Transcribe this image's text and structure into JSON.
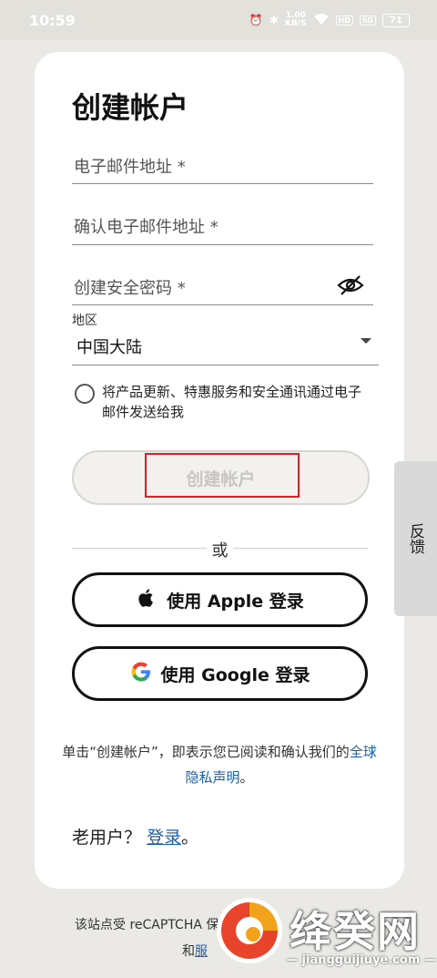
{
  "status_bar": {
    "time": "10:59",
    "net_speed_value": "1.00",
    "net_speed_unit": "KB/S",
    "hd_badge": "HD",
    "signal_label": "5G",
    "battery": "71"
  },
  "form": {
    "title": "创建帐户",
    "email_placeholder": "电子邮件地址 *",
    "confirm_email_placeholder": "确认电子邮件地址 *",
    "password_placeholder": "创建安全密码 *",
    "region_label": "地区",
    "region_value": "中国大陆",
    "marketing_optin": "将产品更新、特惠服务和安全通讯通过电子邮件发送给我",
    "create_button": "创建帐户",
    "or": "或",
    "apple_button": "使用 Apple 登录",
    "google_button": "使用 Google 登录",
    "legal_prefix": "单击“创建帐户”，即表示您已阅读和确认我们的",
    "legal_link": "全球隐私声明",
    "legal_suffix": "。",
    "existing_user": "老用户？",
    "login_link": "登录",
    "login_suffix": "。"
  },
  "feedback_tab": "反馈",
  "footer": {
    "recaptcha_text": "该站点受 reCAPTCHA 保",
    "line2_prefix": "和",
    "line2_link": "服"
  },
  "watermark": {
    "name": "绛癸网",
    "url": "jiangguijiuye.com"
  },
  "colors": {
    "background": "#ebe9e5",
    "link": "#1a5fb4",
    "highlight": "#e02020"
  }
}
